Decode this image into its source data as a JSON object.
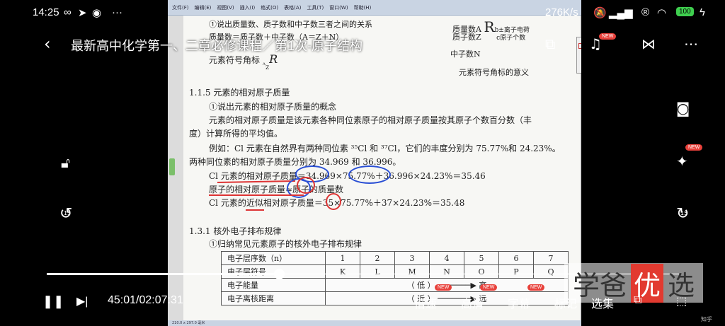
{
  "status_bar": {
    "time": "14:25",
    "speed": "276K/s",
    "battery": "100",
    "icons": [
      "bilibili-icon",
      "telegram-icon",
      "wechat-icon",
      "more-icon",
      "mute-icon",
      "signal-icon",
      "r-icon",
      "wifi-icon",
      "charging-icon"
    ]
  },
  "header": {
    "title": "最新高中化学第一、二章必修课程／第1次-原子结构",
    "new_badge": "NEW"
  },
  "document": {
    "toolbar_items": [
      "文件(F)",
      "编辑(E)",
      "视图(V)",
      "插入(I)",
      "格式(O)",
      "表格(A)",
      "工具(T)",
      "窗口(W)",
      "帮助(H)"
    ],
    "top_lines": {
      "l1": "①说出质量数、质子数和中子数三者之间的关系",
      "l2": "质量数＝质子数＋中子数（A＝Z＋N）",
      "l3_prefix": "元素符号角标",
      "right1": "质量数A",
      "right1b": "b±离子电荷",
      "right2": "质子数Z",
      "right2b": "c原子个数",
      "right3": "中子数N",
      "right4": "元素符号角标的意义"
    },
    "section_1_1_5": "1.1.5  元素的相对原子质量",
    "concept_title": "①说出元素的相对原子质量的概念",
    "para1": "元素的相对原子质量是该元素各种同位素原子的相对原子质量按其原子个数百分数（丰",
    "para2": "度）计算所得的平均值。",
    "example1": "例如：Cl 元素在自然界有两种同位素 ³⁵Cl 和 ³⁷Cl，它们的丰度分别为 75.77%和 24.23%。",
    "example2": "两种同位素的相对原子质量分别为 34.969 和 36.996。",
    "calc1": "Cl 元素的相对原子质量＝34.969×75.77%＋36.996×24.23%＝35.46",
    "calc2": "原子的相对原子质量≈原子的质量数",
    "calc3": "Cl 元素的近似相对原子质量＝35×75.77%＋37×24.23%＝35.48",
    "section_1_3_1": "1.3.1  核外电子排布规律",
    "rule_title": "①归纳常见元素原子的核外电子排布规律",
    "table": {
      "row1": {
        "label": "电子层序数（n）",
        "cells": [
          "1",
          "2",
          "3",
          "4",
          "5",
          "6",
          "7"
        ]
      },
      "row2": {
        "label": "电子层符号",
        "cells": [
          "K",
          "L",
          "M",
          "N",
          "O",
          "P",
          "Q"
        ]
      },
      "row3": {
        "label": "电子能量",
        "low": "（ 低 ）",
        "high": "高"
      },
      "row4": {
        "label": "电子离核距离",
        "near": "（ 近 ）",
        "far": "远"
      }
    },
    "status_text": "210.0 x 297.0 毫米"
  },
  "player": {
    "time_display": "45:01/02:07:31",
    "progress": 0.367,
    "controls": {
      "speed": "倍速",
      "quality": "高清",
      "subtitle": "字幕",
      "bookmark": "标记",
      "episodes": "选集"
    },
    "new_badge": "NEW",
    "rewind_label": "15",
    "forward_label": "15"
  },
  "watermark": {
    "part1": "学爸",
    "highlight": "优",
    "part2": "选"
  },
  "corner_text": "知乎"
}
